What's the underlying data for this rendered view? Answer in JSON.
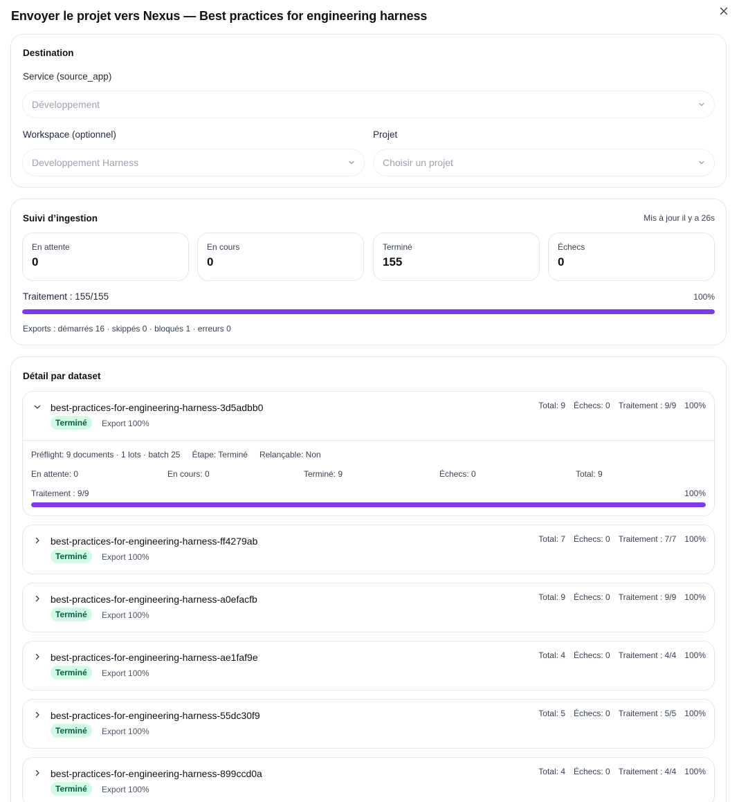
{
  "modal": {
    "title": "Envoyer le projet vers Nexus — Best practices for engineering harness",
    "close_icon": "close-icon"
  },
  "destination": {
    "title": "Destination",
    "service_label": "Service (source_app)",
    "service_value": "Développement",
    "workspace_label": "Workspace (optionnel)",
    "workspace_value": "Developpement Harness",
    "project_label": "Projet",
    "project_placeholder": "Choisir un projet"
  },
  "ingestion": {
    "title": "Suivi d’ingestion",
    "updated": "Mis à jour il y a 26s",
    "stats": [
      {
        "label": "En attente",
        "value": "0"
      },
      {
        "label": "En cours",
        "value": "0"
      },
      {
        "label": "Terminé",
        "value": "155"
      },
      {
        "label": "Échecs",
        "value": "0"
      }
    ],
    "progress_label": "Traitement : 155/155",
    "progress_percent_text": "100%",
    "progress_fraction": 1.0,
    "exports_summary": "Exports : démarrés 16 · skippés 0 · bloqués 1 · erreurs 0"
  },
  "datasets": {
    "title": "Détail par dataset",
    "items": [
      {
        "name": "best-practices-for-engineering-harness-3d5adbb0",
        "status": "Terminé",
        "export": "Export 100%",
        "total": "Total: 9",
        "failures": "Échecs: 0",
        "processing": "Traitement : 9/9",
        "percent": "100%",
        "expanded": true,
        "detail": {
          "preflight": "Préflight: 9 documents · 1 lots · batch 25",
          "step": "Étape: Terminé",
          "relaunchable": "Relançable: Non",
          "pending": "En attente: 0",
          "in_progress": "En cours: 0",
          "done": "Terminé: 9",
          "failures": "Échecs: 0",
          "total": "Total: 9",
          "progress_label": "Traitement : 9/9",
          "progress_percent_text": "100%",
          "progress_fraction": 1.0
        }
      },
      {
        "name": "best-practices-for-engineering-harness-ff4279ab",
        "status": "Terminé",
        "export": "Export 100%",
        "total": "Total: 7",
        "failures": "Échecs: 0",
        "processing": "Traitement : 7/7",
        "percent": "100%",
        "expanded": false
      },
      {
        "name": "best-practices-for-engineering-harness-a0efacfb",
        "status": "Terminé",
        "export": "Export 100%",
        "total": "Total: 9",
        "failures": "Échecs: 0",
        "processing": "Traitement : 9/9",
        "percent": "100%",
        "expanded": false
      },
      {
        "name": "best-practices-for-engineering-harness-ae1faf9e",
        "status": "Terminé",
        "export": "Export 100%",
        "total": "Total: 4",
        "failures": "Échecs: 0",
        "processing": "Traitement : 4/4",
        "percent": "100%",
        "expanded": false
      },
      {
        "name": "best-practices-for-engineering-harness-55dc30f9",
        "status": "Terminé",
        "export": "Export 100%",
        "total": "Total: 5",
        "failures": "Échecs: 0",
        "processing": "Traitement : 5/5",
        "percent": "100%",
        "expanded": false
      },
      {
        "name": "best-practices-for-engineering-harness-899ccd0a",
        "status": "Terminé",
        "export": "Export 100%",
        "total": "Total: 4",
        "failures": "Échecs: 0",
        "processing": "Traitement : 4/4",
        "percent": "100%",
        "expanded": false
      }
    ]
  },
  "colors": {
    "accent": "#7c3aed",
    "badge_bg": "#d1fae5",
    "badge_text": "#065f46",
    "border": "#e5e7eb"
  }
}
